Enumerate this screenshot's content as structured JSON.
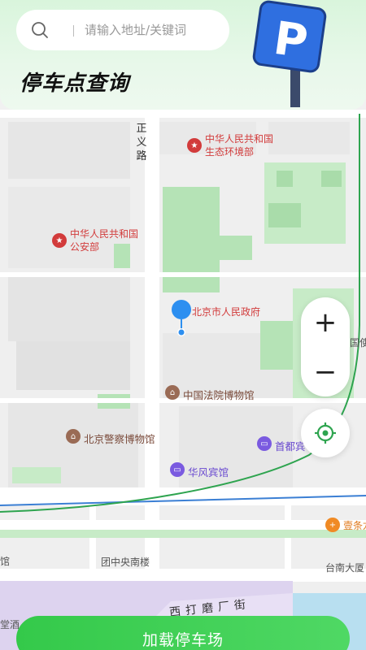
{
  "search": {
    "placeholder": "请输入地址/关键词"
  },
  "header": {
    "title": "停车点查询"
  },
  "sign": {
    "letter": "P",
    "color": "#2f6fe0"
  },
  "map": {
    "road_label": "正义路",
    "road_label_chars": [
      "正",
      "义",
      "路"
    ],
    "bottom_road": "西打磨厂街",
    "pois": {
      "ministry_env_line1": "中华人民共和国",
      "ministry_env_line2": "生态环境部",
      "ministry_ps_line1": "中华人民共和国",
      "ministry_ps_line2": "公安部",
      "city_gov": "北京市人民政府",
      "court_museum": "中国法院博物馆",
      "police_museum": "北京警察博物馆",
      "huafeng_hotel": "华风宾馆",
      "capital_hotel": "首都宾",
      "yitiao": "壹条龙",
      "tuanzhongyang": "团中央南楼",
      "tainan": "台南大厦",
      "guoji_partial": "国使",
      "left_guan": "馆",
      "left_tangjiu": "堂酒"
    }
  },
  "controls": {
    "zoom_in": "+",
    "zoom_out": "−"
  },
  "actions": {
    "load_button": "加载停车场"
  },
  "colors": {
    "accent": "#34c94a",
    "marker": "#2d8ff0",
    "poi_red": "#d23b3b"
  }
}
